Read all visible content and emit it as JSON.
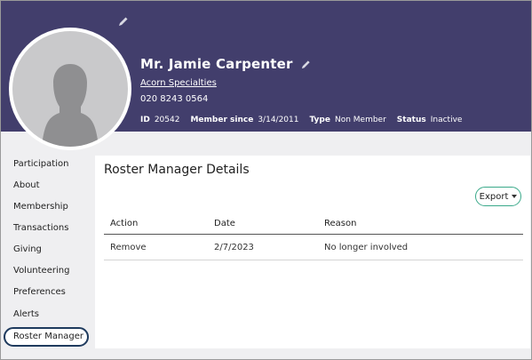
{
  "profile": {
    "name": "Mr. Jamie Carpenter",
    "organization": "Acorn Specialties",
    "phone": "020 8243 0564",
    "meta": {
      "id_label": "ID",
      "id_value": "20542",
      "member_since_label": "Member since",
      "member_since_value": "3/14/2011",
      "type_label": "Type",
      "type_value": "Non Member",
      "status_label": "Status",
      "status_value": "Inactive"
    }
  },
  "sidebar": {
    "items": [
      {
        "label": "Participation"
      },
      {
        "label": "About"
      },
      {
        "label": "Membership"
      },
      {
        "label": "Transactions"
      },
      {
        "label": "Giving"
      },
      {
        "label": "Volunteering"
      },
      {
        "label": "Preferences"
      },
      {
        "label": "Alerts"
      },
      {
        "label": "Roster Manager"
      }
    ],
    "active": "Roster Manager"
  },
  "panel": {
    "title": "Roster Manager Details",
    "export_label": "Export",
    "columns": [
      "Action",
      "Date",
      "Reason"
    ],
    "rows": [
      [
        "Remove",
        "2/7/2023",
        "No longer involved"
      ]
    ]
  },
  "colors": {
    "header_bg": "#423e6c",
    "active_border": "#1f3b5e",
    "export_border": "#3aa98a"
  }
}
